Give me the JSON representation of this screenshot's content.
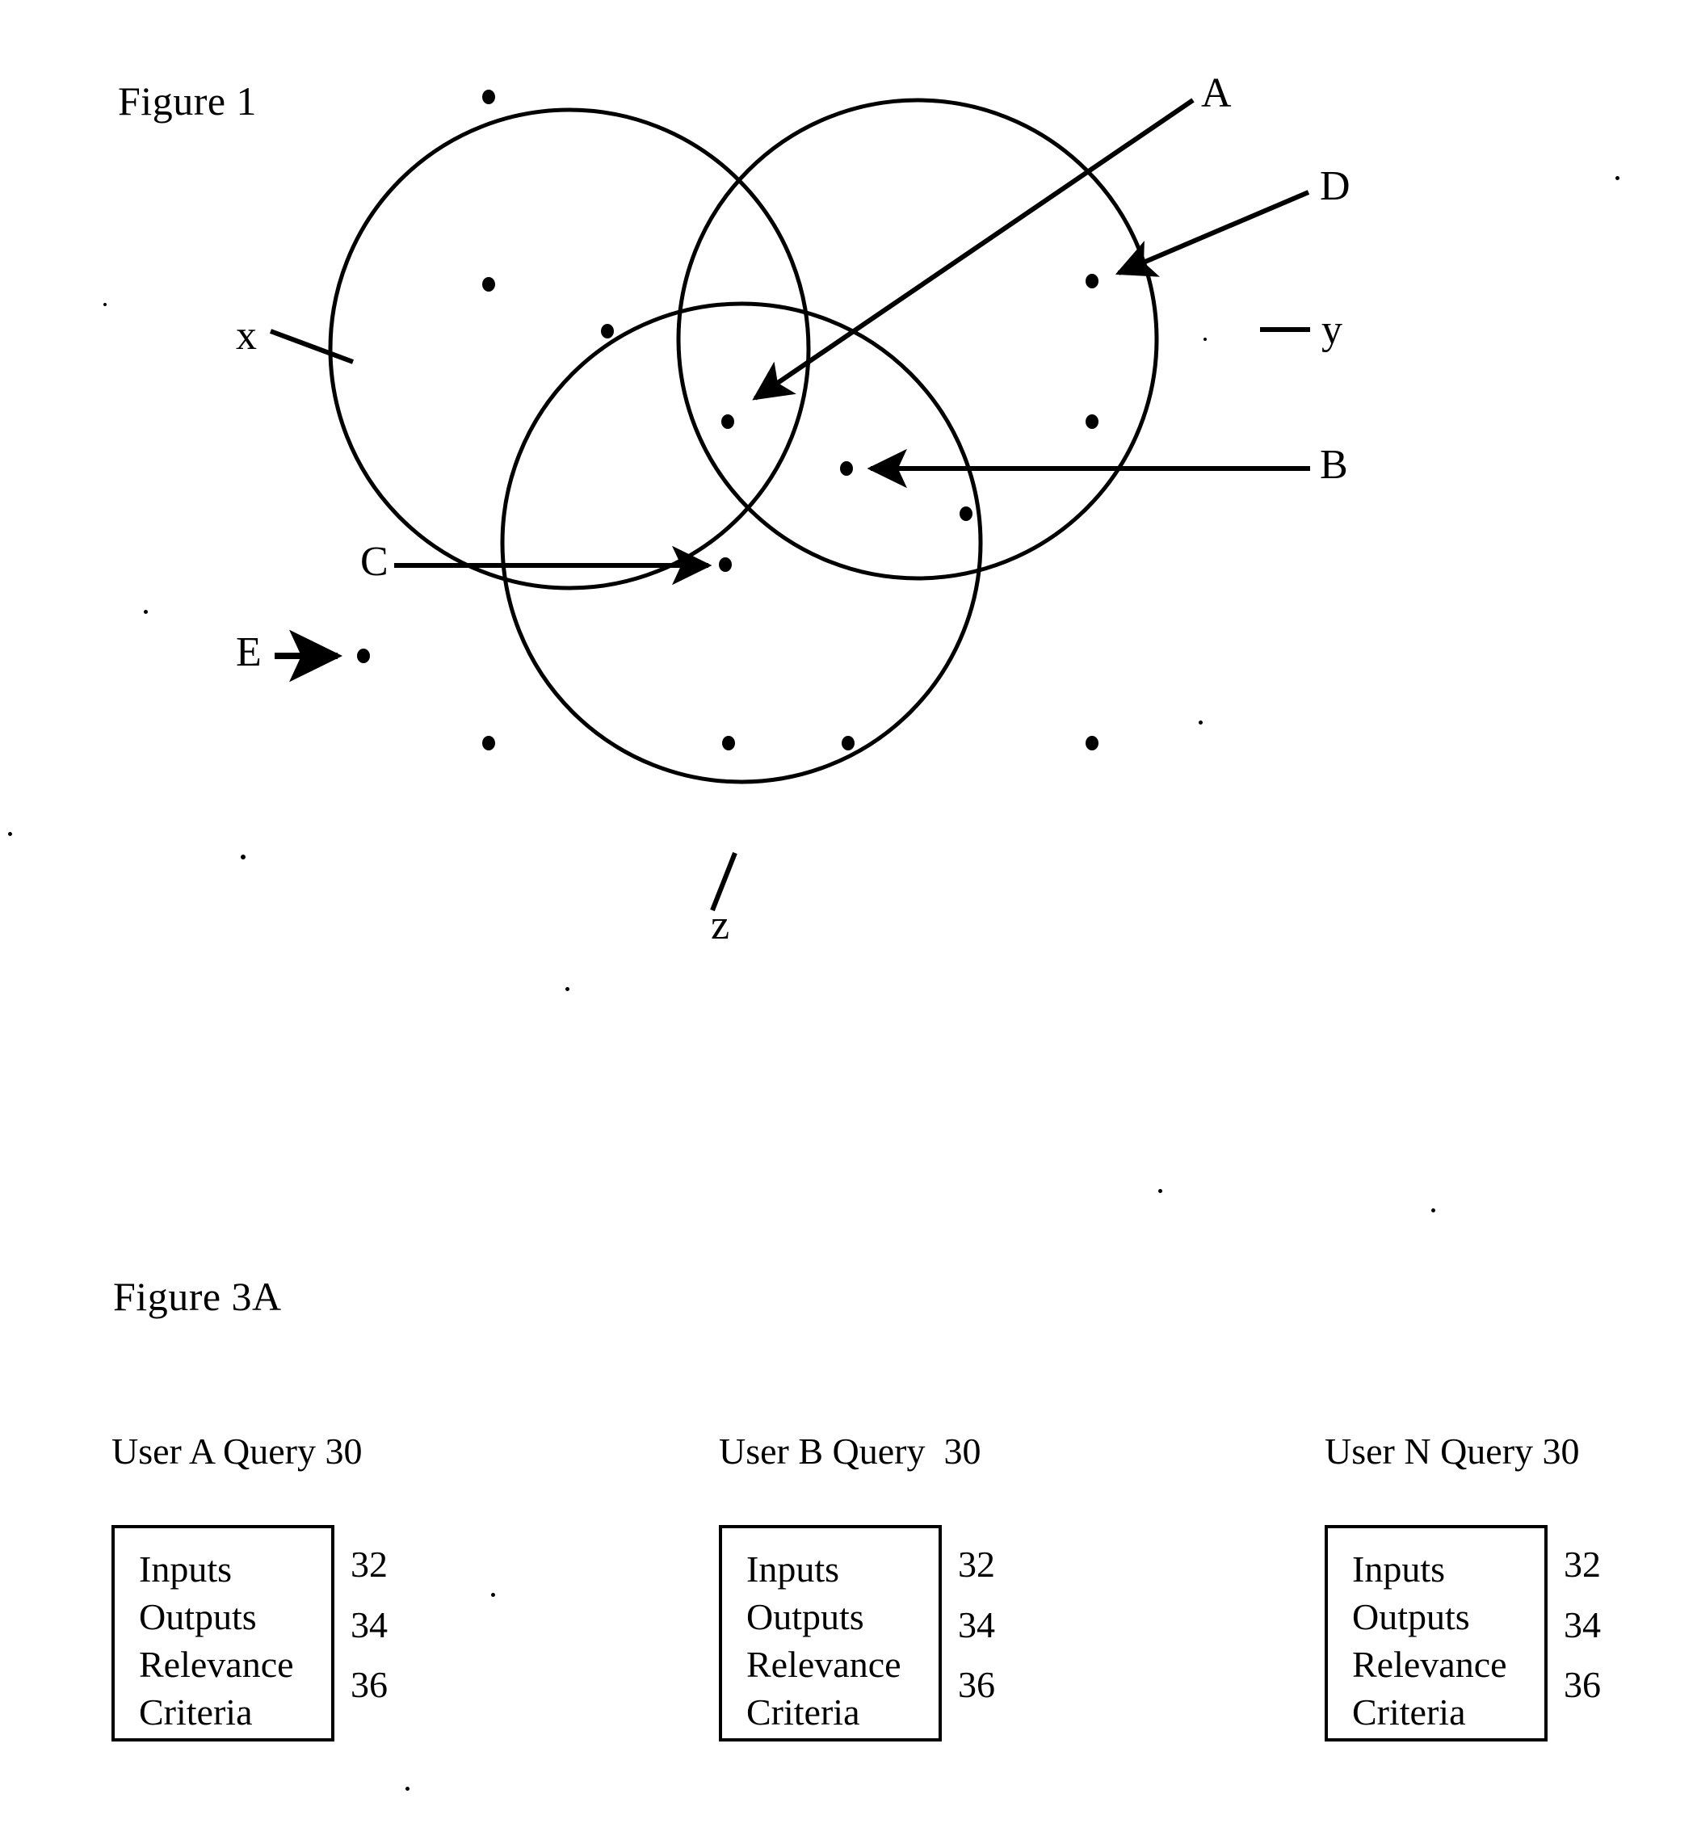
{
  "figure1": {
    "title": "Figure 1",
    "set_labels": [
      {
        "id": "x",
        "text": "x"
      },
      {
        "id": "y",
        "text": "y"
      },
      {
        "id": "z",
        "text": "z"
      }
    ],
    "callouts": [
      {
        "id": "A",
        "text": "A"
      },
      {
        "id": "B",
        "text": "B"
      },
      {
        "id": "C",
        "text": "C"
      },
      {
        "id": "D",
        "text": "D"
      },
      {
        "id": "E",
        "text": "E"
      }
    ],
    "description": "Three overlapping circles labelled x, y and z forming a Venn diagram populated with point markers; callout arrows A, B, C, D and E point to individual points."
  },
  "figure3a": {
    "title": "Figure 3A",
    "queries": [
      {
        "heading": "User A Query 30",
        "box_lines": [
          "Inputs",
          "Outputs",
          "Relevance",
          "Criteria"
        ],
        "refs": [
          "32",
          "34",
          "36"
        ]
      },
      {
        "heading": "User B Query  30",
        "box_lines": [
          "Inputs",
          "Outputs",
          "Relevance",
          "Criteria"
        ],
        "refs": [
          "32",
          "34",
          "36"
        ]
      },
      {
        "heading": "User N Query 30",
        "box_lines": [
          "Inputs",
          "Outputs",
          "Relevance",
          "Criteria"
        ],
        "refs": [
          "32",
          "34",
          "36"
        ]
      }
    ]
  },
  "chart_data": {
    "type": "scatter",
    "title": "Figure 1",
    "xlabel": "",
    "ylabel": "",
    "xlim": [
      0,
      2101
    ],
    "ylim": [
      0,
      1250
    ],
    "grid": false,
    "legend": "none",
    "circles": [
      {
        "label": "x",
        "cx": 705,
        "cy": 432,
        "r": 296
      },
      {
        "label": "y",
        "cx": 1136,
        "cy": 420,
        "r": 296
      },
      {
        "label": "z",
        "cx": 918,
        "cy": 672,
        "r": 296
      }
    ],
    "points": [
      {
        "x": 605,
        "y": 120,
        "region": "outside"
      },
      {
        "x": 605,
        "y": 352,
        "region": "x"
      },
      {
        "x": 752,
        "y": 410,
        "region": "x"
      },
      {
        "x": 1352,
        "y": 348,
        "region": "y"
      },
      {
        "x": 901,
        "y": 522,
        "region": "x-y-z"
      },
      {
        "x": 1352,
        "y": 522,
        "region": "y"
      },
      {
        "x": 1048,
        "y": 580,
        "region": "x-y-z"
      },
      {
        "x": 1196,
        "y": 636,
        "region": "y-z"
      },
      {
        "x": 898,
        "y": 699,
        "region": "x-z"
      },
      {
        "x": 450,
        "y": 812,
        "region": "outside"
      },
      {
        "x": 605,
        "y": 920,
        "region": "outside"
      },
      {
        "x": 902,
        "y": 920,
        "region": "z"
      },
      {
        "x": 1050,
        "y": 920,
        "region": "z"
      },
      {
        "x": 1352,
        "y": 920,
        "region": "outside"
      }
    ],
    "annotations": [
      {
        "label": "A",
        "points_to": [
          930,
          492
        ],
        "text_at": [
          1496,
          124
        ]
      },
      {
        "label": "B",
        "points_to": [
          1075,
          580
        ],
        "text_at": [
          1638,
          582
        ]
      },
      {
        "label": "C",
        "points_to": [
          880,
          700
        ],
        "text_at": [
          452,
          702
        ]
      },
      {
        "label": "D",
        "points_to": [
          1380,
          338
        ],
        "text_at": [
          1638,
          237
        ]
      },
      {
        "label": "E",
        "points_to": [
          450,
          812
        ],
        "text_at": [
          296,
          812
        ]
      },
      {
        "label": "x",
        "points_to": [
          432,
          444
        ],
        "text_at": [
          300,
          418
        ]
      },
      {
        "label": "y",
        "points_to": [
          1562,
          412
        ],
        "text_at": [
          1640,
          413
        ]
      },
      {
        "label": "z",
        "points_to": [
          912,
          1058
        ],
        "text_at": [
          888,
          1145
        ]
      }
    ]
  }
}
